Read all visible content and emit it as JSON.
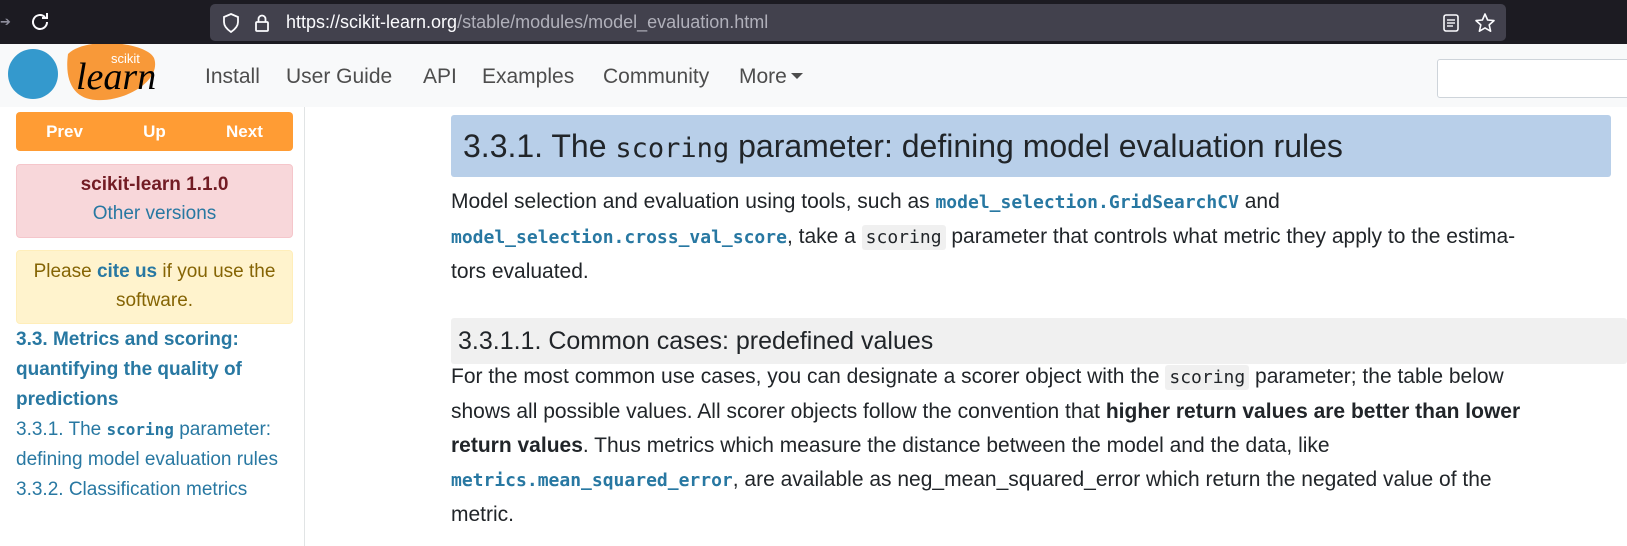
{
  "browser": {
    "url_host": "https://scikit-learn.org",
    "url_path": "/stable/modules/model_evaluation.html"
  },
  "navbar": {
    "logo_text_small": "scikit",
    "logo_text_big": "learn",
    "links": [
      "Install",
      "User Guide",
      "API",
      "Examples",
      "Community",
      "More"
    ]
  },
  "sidebar": {
    "nav": {
      "prev": "Prev",
      "up": "Up",
      "next": "Next"
    },
    "version_title": "scikit-learn 1.1.0",
    "version_link": "Other versions",
    "cite_pre": "Please ",
    "cite_link": "cite us",
    "cite_post": " if you use the software.",
    "toc_head": "3.3. Metrics and scoring: quantifying the quality of predictions",
    "toc_item1_pre": "3.3.1. The ",
    "toc_item1_code": "scoring",
    "toc_item1_post": " parameter: defining model evaluation rules",
    "toc_item2": "3.3.2. Classification metrics"
  },
  "main": {
    "h2_pre": "3.3.1. The ",
    "h2_code": "scoring",
    "h2_post": " parameter: defining model evaluation rules",
    "p1_a": "Model selection and evaluation using tools, such as ",
    "p1_link1": "model_selection.GridSearchCV",
    "p1_b": " and",
    "p1_link2": "model_selection.cross_val_score",
    "p1_c": ", take a ",
    "p1_code": "scoring",
    "p1_d": " parameter that controls what metric they apply to the estima-",
    "p1_e": "tors evaluated.",
    "h3": "3.3.1.1. Common cases: predefined values",
    "p2_a": "For the most common use cases, you can designate a scorer object with the ",
    "p2_code": "scoring",
    "p2_b": " parameter; the table below",
    "p2_c": "shows all possible values. All scorer objects follow the convention that ",
    "p2_bold1": "higher return values are better than lower",
    "p2_bold2": "return values",
    "p2_d": ". Thus metrics which measure the distance between the model and the data, like",
    "p2_link": "metrics.mean_squared_error",
    "p2_e": ", are available as neg_mean_squared_error which return the negated value of the",
    "p2_f": "metric."
  },
  "colors": {
    "accent_orange": "#ff9c34",
    "link_blue": "#2878a2",
    "heading_bg": "#b8cfe9"
  }
}
